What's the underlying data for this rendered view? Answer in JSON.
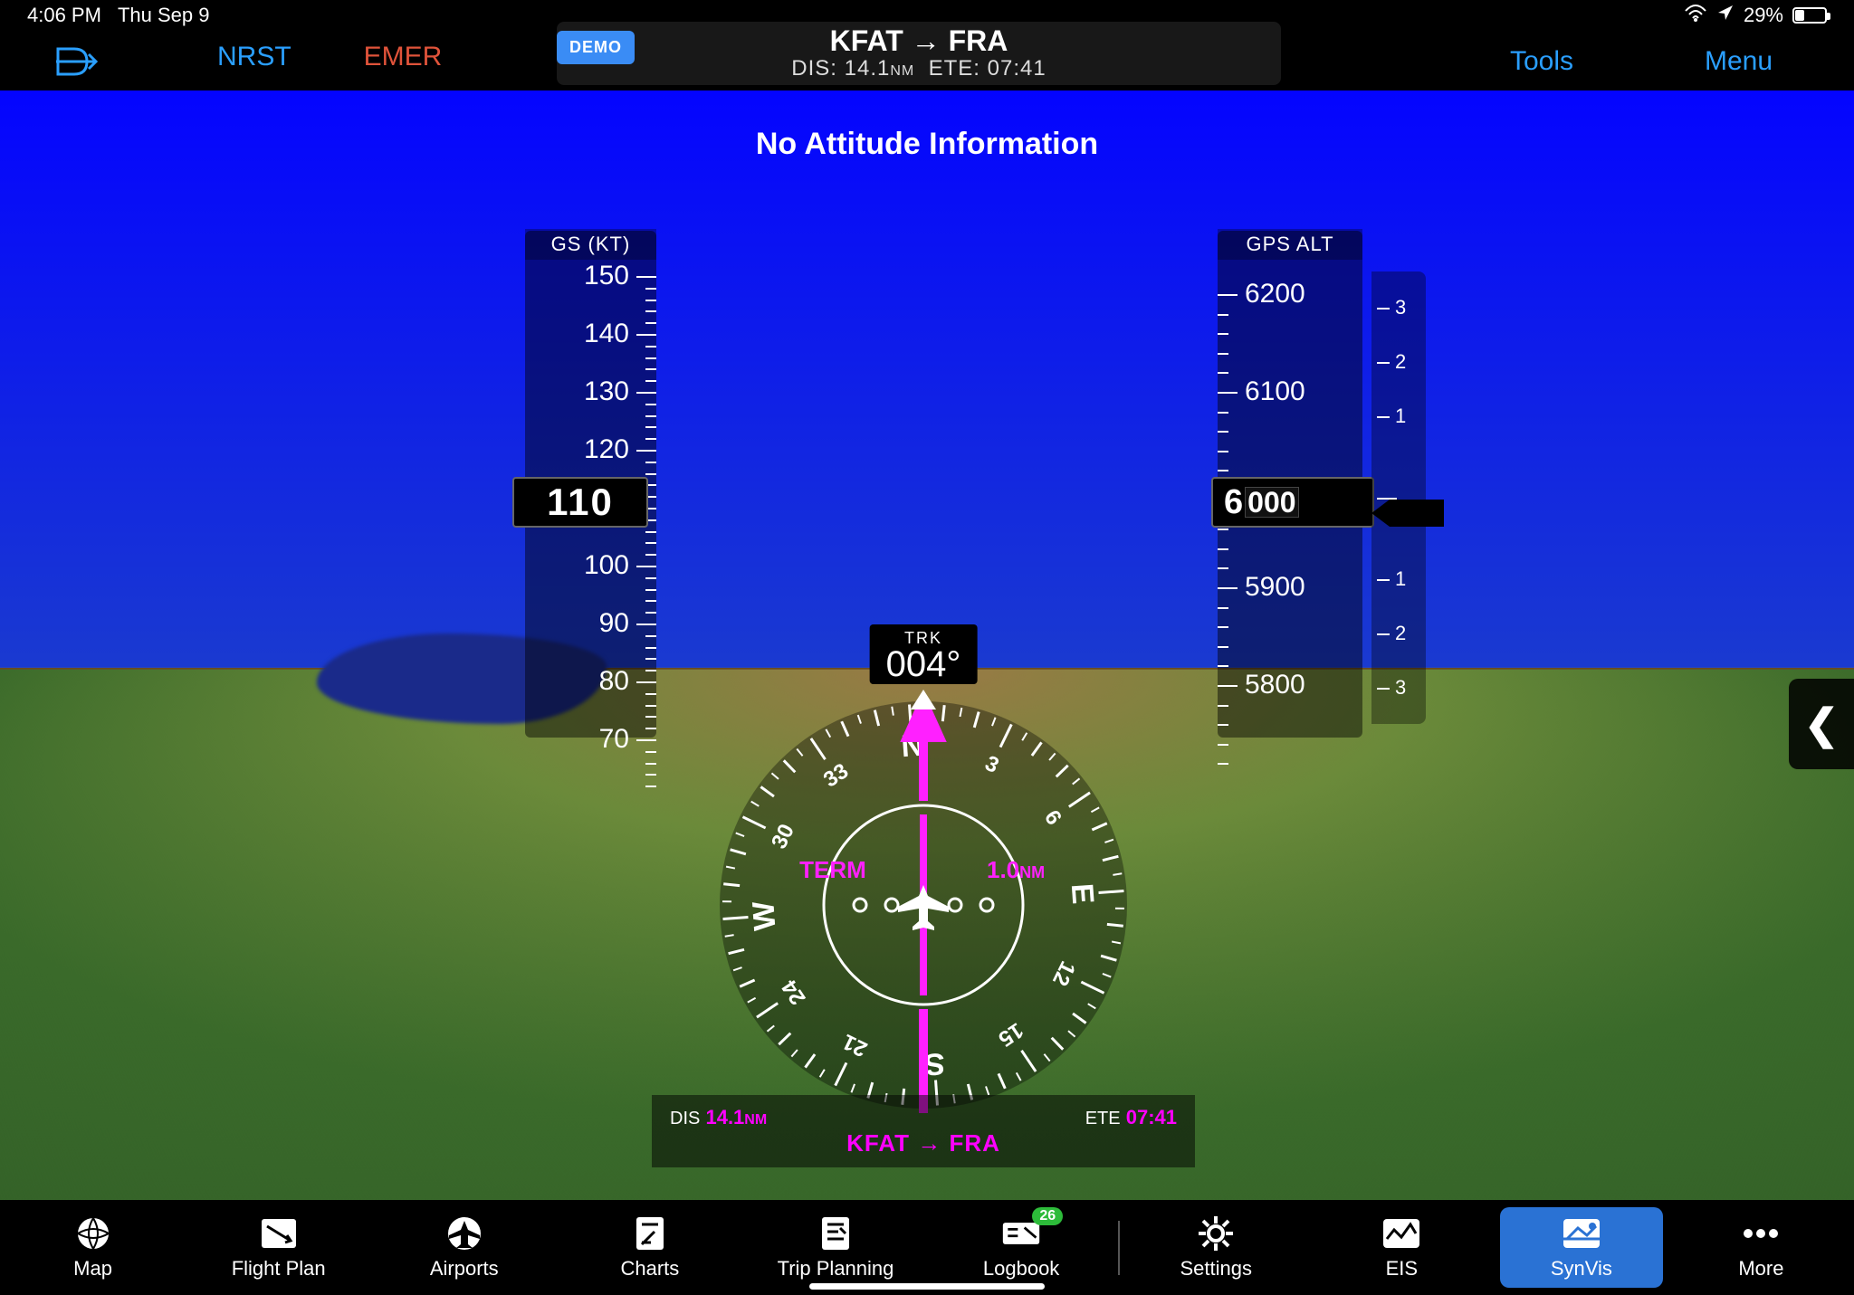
{
  "status": {
    "time": "4:06 PM",
    "date": "Thu Sep 9",
    "battery": "29%"
  },
  "topbar": {
    "nrst": "NRST",
    "emer": "EMER",
    "demo": "DEMO",
    "route": "KFAT → FRA",
    "dis_label": "DIS:",
    "dis_val": "14.1",
    "dis_unit": "NM",
    "ete_label": "ETE:",
    "ete_val": "07:41",
    "tools": "Tools",
    "menu": "Menu"
  },
  "pfd": {
    "warning": "No Attitude Information",
    "speed": {
      "header": "GS  (KT)",
      "value": "110",
      "ticks": [
        "150",
        "140",
        "130",
        "120",
        "110",
        "100",
        "90",
        "80",
        "70"
      ]
    },
    "alt": {
      "header": "GPS ALT",
      "value_major": "6",
      "value_minor": "000",
      "ticks": [
        "6200",
        "6100",
        "6000",
        "5900",
        "5800"
      ]
    },
    "vsi_ticks": [
      "3",
      "2",
      "1",
      "1",
      "2",
      "3"
    ],
    "hsi": {
      "trk_label": "TRK",
      "trk": "004°",
      "mode": "TERM",
      "scale": "1.0",
      "scale_unit": "NM",
      "dis_label": "DIS",
      "dis": "14.1",
      "dis_unit": "NM",
      "ete_label": "ETE",
      "ete": "07:41",
      "route": "KFAT → FRA",
      "card": [
        "N",
        "3",
        "6",
        "E",
        "12",
        "15",
        "S",
        "21",
        "24",
        "W",
        "30",
        "33"
      ]
    }
  },
  "tabs": {
    "map": "Map",
    "flightplan": "Flight Plan",
    "airports": "Airports",
    "charts": "Charts",
    "trip": "Trip Planning",
    "logbook": "Logbook",
    "logbook_badge": "26",
    "settings": "Settings",
    "eis": "EIS",
    "synvis": "SynVis",
    "more": "More"
  }
}
